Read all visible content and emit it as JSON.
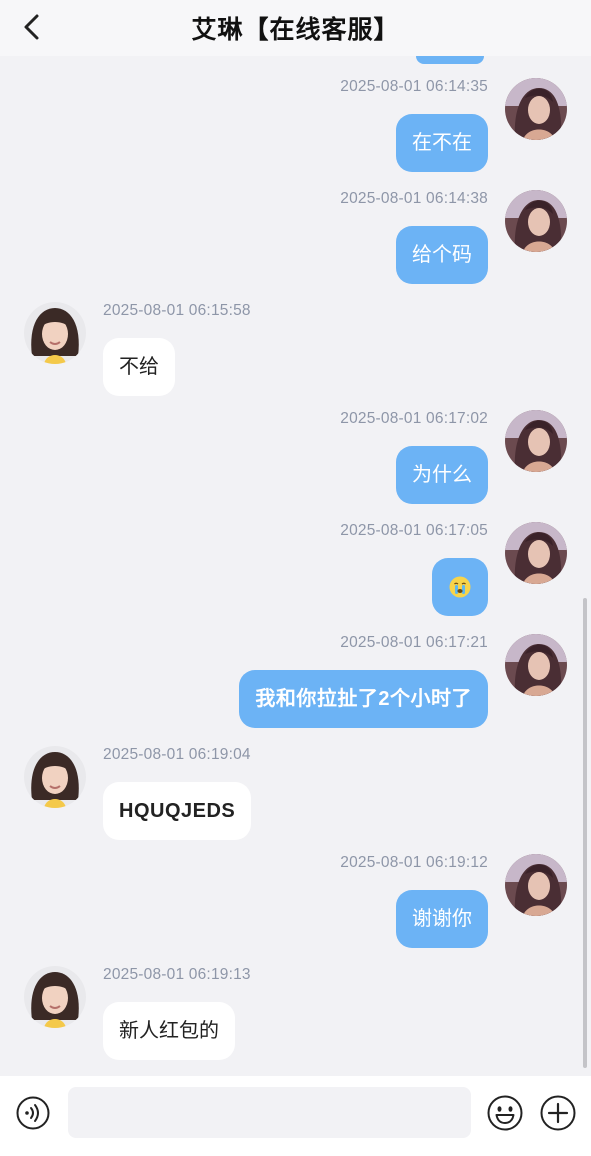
{
  "header": {
    "title": "艾琳【在线客服】"
  },
  "messages": [
    {
      "dir": "out",
      "time": "2025-08-01 06:14:35",
      "text": "在不在"
    },
    {
      "dir": "out",
      "time": "2025-08-01 06:14:38",
      "text": "给个码"
    },
    {
      "dir": "in",
      "time": "2025-08-01 06:15:58",
      "text": "不给"
    },
    {
      "dir": "out",
      "time": "2025-08-01 06:17:02",
      "text": "为什么"
    },
    {
      "dir": "out",
      "time": "2025-08-01 06:17:05",
      "text": "",
      "emoji": "crying-face"
    },
    {
      "dir": "out",
      "time": "2025-08-01 06:17:21",
      "text": "我和你拉扯了2个小时了"
    },
    {
      "dir": "in",
      "time": "2025-08-01 06:19:04",
      "text": "HQUQJEDS"
    },
    {
      "dir": "out",
      "time": "2025-08-01 06:19:12",
      "text": "谢谢你"
    },
    {
      "dir": "in",
      "time": "2025-08-01 06:19:13",
      "text": "新人红包的"
    }
  ],
  "composer": {
    "value": "",
    "placeholder": ""
  },
  "icons": {
    "back": "chevron-left-icon",
    "voice": "voice-icon",
    "emoji": "smiley-icon",
    "more": "plus-icon"
  },
  "colors": {
    "outgoing_bubble": "#6cb3f5",
    "incoming_bubble": "#ffffff",
    "background": "#f2f2f5",
    "timestamp": "#8e96a8"
  }
}
